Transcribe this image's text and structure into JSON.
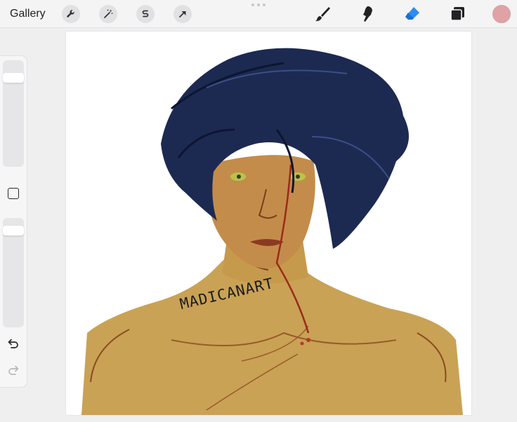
{
  "toolbar": {
    "gallery_label": "Gallery",
    "left_tools": [
      {
        "name": "wrench-icon",
        "label": "Actions"
      },
      {
        "name": "magic-wand-icon",
        "label": "Adjustments"
      },
      {
        "name": "selection-icon",
        "label": "Selection"
      },
      {
        "name": "arrow-cursor-icon",
        "label": "Transform"
      }
    ],
    "right_tools": [
      {
        "name": "brush-icon",
        "label": "Paint"
      },
      {
        "name": "smudge-icon",
        "label": "Smudge"
      },
      {
        "name": "eraser-icon",
        "label": "Erase",
        "active": true
      },
      {
        "name": "layers-icon",
        "label": "Layers"
      }
    ],
    "current_color": "#e0a2a4",
    "accent_color": "#2c8cf4"
  },
  "sidebar": {
    "brush_size_level": 0.87,
    "opacity_level": 0.92,
    "undo_icon": "undo-icon",
    "redo_icon": "redo-icon"
  },
  "canvas": {
    "background": "#ffffff",
    "signature_text": "MADICANART"
  }
}
